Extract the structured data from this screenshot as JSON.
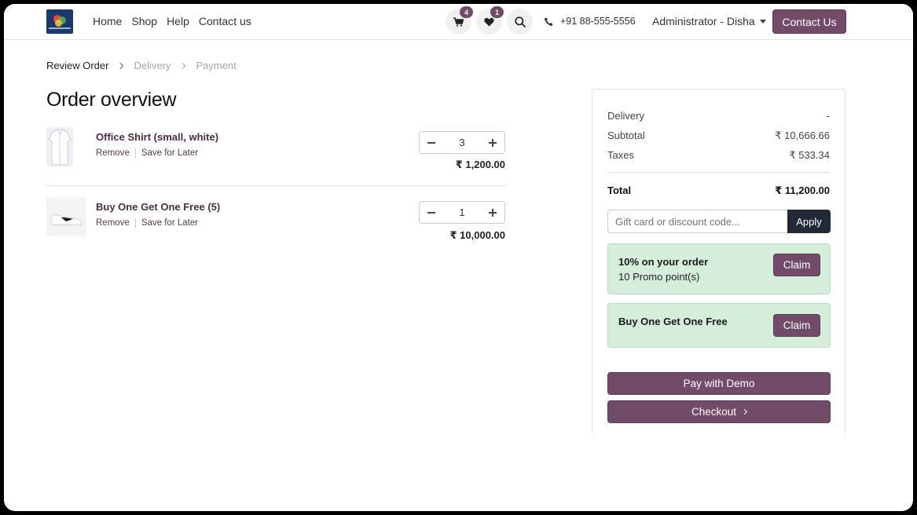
{
  "header": {
    "nav": [
      "Home",
      "Shop",
      "Help",
      "Contact us"
    ],
    "cart_count": "4",
    "wishlist_count": "1",
    "phone": "+91 88-555-5556",
    "user": "Administrator - Disha",
    "contact_button": "Contact Us"
  },
  "breadcrumb": {
    "step1": "Review Order",
    "step2": "Delivery",
    "step3": "Payment"
  },
  "page_title": "Order overview",
  "items": [
    {
      "name": "Office Shirt (small, white)",
      "remove": "Remove",
      "save": "Save for Later",
      "qty": "3",
      "price": "₹ 1,200.00"
    },
    {
      "name": "Buy One Get One Free (5)",
      "remove": "Remove",
      "save": "Save for Later",
      "qty": "1",
      "price": "₹ 10,000.00"
    }
  ],
  "summary": {
    "delivery_label": "Delivery",
    "delivery_value": "-",
    "subtotal_label": "Subtotal",
    "subtotal_value": "₹ 10,666.66",
    "taxes_label": "Taxes",
    "taxes_value": "₹ 533.34",
    "total_label": "Total",
    "total_value": "₹ 11,200.00",
    "promo_placeholder": "Gift card or discount code...",
    "apply_label": "Apply",
    "rewards": [
      {
        "title": "10% on your order",
        "subtitle": "10 Promo point(s)",
        "claim": "Claim"
      },
      {
        "title": "Buy One Get One Free",
        "claim": "Claim"
      }
    ],
    "pay_demo_label": "Pay with Demo",
    "checkout_label": "Checkout"
  },
  "colors": {
    "accent": "#714b67",
    "dark_button": "#212a36",
    "reward_bg": "#d4eedb"
  }
}
